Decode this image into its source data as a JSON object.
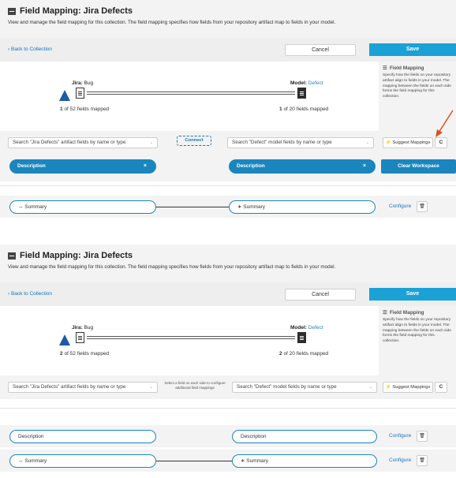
{
  "panels": [
    {
      "title": "Field Mapping: Jira Defects",
      "description": "View and manage the field mapping for this collection. The field mapping specifies how fields from your repository artifact map to fields in your model.",
      "back_link": "Back to Collection",
      "cancel_label": "Cancel",
      "save_label": "Save",
      "left_prefix": "Jira:",
      "left_type": "Bug",
      "right_prefix": "Model:",
      "right_type": "Defect",
      "left_count": "1",
      "left_count_suffix": "of 52 fields mapped",
      "right_count": "1",
      "right_count_suffix": "of 20 fields mapped",
      "sidebar_title": "Field Mapping",
      "sidebar_text": "Specify how the fields on your repository artifact align to fields in your model. The mapping between the fields on each side forms the field mapping for this collection.",
      "left_search": "Search \"Jira Defects\" artifact fields by name or type",
      "right_search": "Search \"Defect\" model fields by name or type",
      "connect_label": "Connect",
      "suggest_label": "Suggest Mappings",
      "refresh_label": "C",
      "left_selected": "Description",
      "right_selected": "Description",
      "remove_symbol": "×",
      "clear_label": "Clear Workspace",
      "mappings": [
        {
          "left": "↔ Summary",
          "right": "∗ Summary",
          "configure": "Configure",
          "delete_icon": "trash-icon"
        }
      ]
    },
    {
      "title": "Field Mapping: Jira Defects",
      "description": "View and manage the field mapping for this collection. The field mapping specifies how fields from your repository artifact map to fields in your model.",
      "back_link": "Back to Collection",
      "cancel_label": "Cancel",
      "save_label": "Save",
      "left_prefix": "Jira:",
      "left_type": "Bug",
      "right_prefix": "Model:",
      "right_type": "Defect",
      "left_count": "2",
      "left_count_suffix": "of 52 fields mapped",
      "right_count": "2",
      "right_count_suffix": "of 20 fields mapped",
      "sidebar_title": "Field Mapping",
      "sidebar_text": "Specify how the fields on your repository artifact align to fields in your model. The mapping between the fields on each side forms the field mapping for this collection.",
      "left_search": "Search \"Jira Defects\" artifact fields by name or type",
      "right_search": "Search \"Defect\" model fields by name or type",
      "hint": "Select a field on each side to configure additional field mappings",
      "suggest_label": "Suggest Mappings",
      "refresh_label": "C",
      "mappings": [
        {
          "left": "Description",
          "right": "Description",
          "configure": "Configure",
          "delete_icon": "trash-icon"
        },
        {
          "left": "↔ Summary",
          "right": "∗ Summary",
          "configure": "Configure",
          "delete_icon": "trash-icon"
        }
      ]
    }
  ],
  "colors": {
    "accent": "#1a86bd",
    "save": "#1aa1d6",
    "jira_blue": "#1b5aa8",
    "annotation_arrow": "#d9531e"
  }
}
